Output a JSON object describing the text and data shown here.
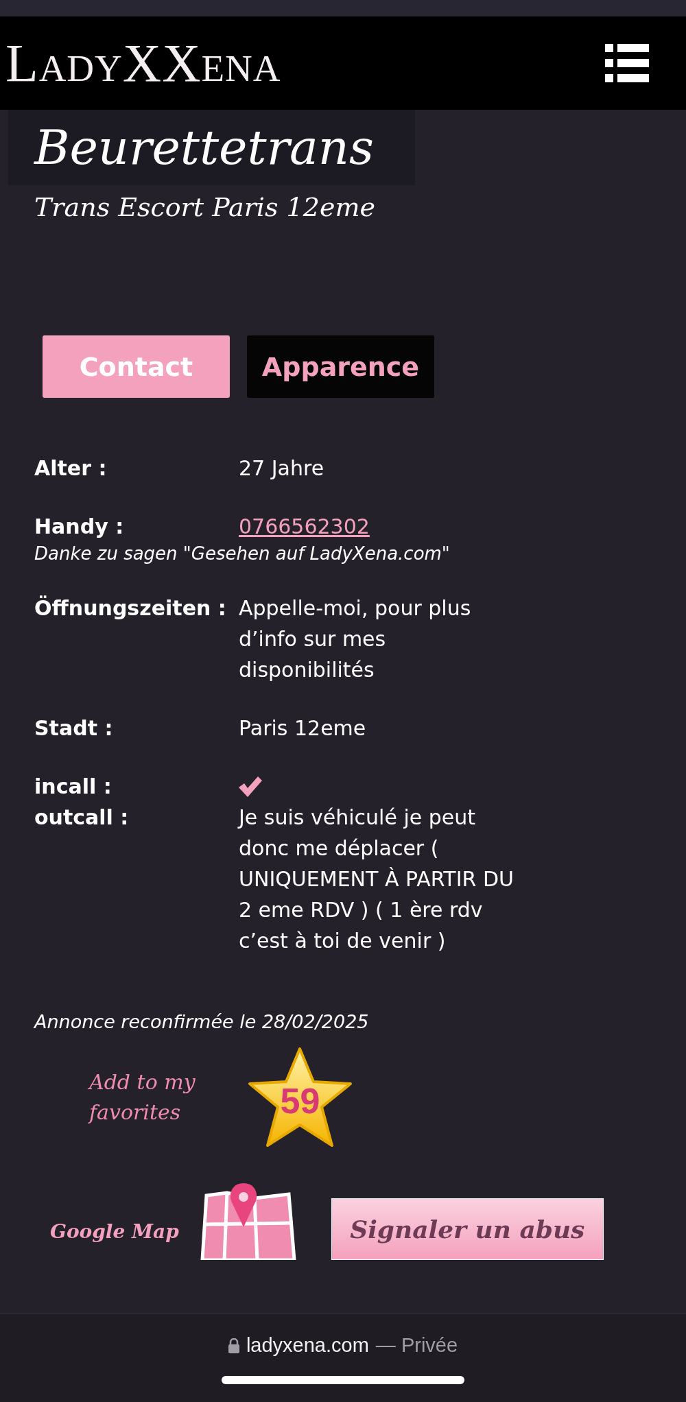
{
  "header": {
    "logo": "LadyXXena"
  },
  "profile": {
    "name": "Beurettetrans",
    "subtitle": "Trans Escort Paris 12eme"
  },
  "tabs": [
    {
      "label": "Contact",
      "selected": true
    },
    {
      "label": "Apparence",
      "selected": false
    }
  ],
  "details": [
    {
      "kind": "text",
      "label": "Alter :",
      "value": "27 Jahre"
    },
    {
      "kind": "phone",
      "label": "Handy :",
      "value": "0766562302",
      "note": "Danke zu sagen \"Gesehen auf LadyXena.com\""
    },
    {
      "kind": "text",
      "label": "Öffnungszeiten :",
      "value": "Appelle-moi, pour plus d’info sur mes disponibilités"
    },
    {
      "kind": "text",
      "label": "Stadt :",
      "value": "Paris 12eme"
    },
    {
      "kind": "check",
      "label": "incall :",
      "checked": true
    },
    {
      "kind": "text",
      "label": "outcall :",
      "value": "Je suis véhiculé je peut donc me déplacer ( UNIQUEMENT À PARTIR DU 2 eme RDV ) ( 1 ère rdv c’est à toi de venir )"
    }
  ],
  "confirmed": "Annonce reconfirmée le 28/02/2025",
  "favorites": {
    "label": "Add to my favorites",
    "count": "59"
  },
  "map_link": "Google Map",
  "report_button": "Signaler un abus",
  "browser_bar": {
    "domain": "ladyxena.com",
    "mode": "— Privée"
  }
}
